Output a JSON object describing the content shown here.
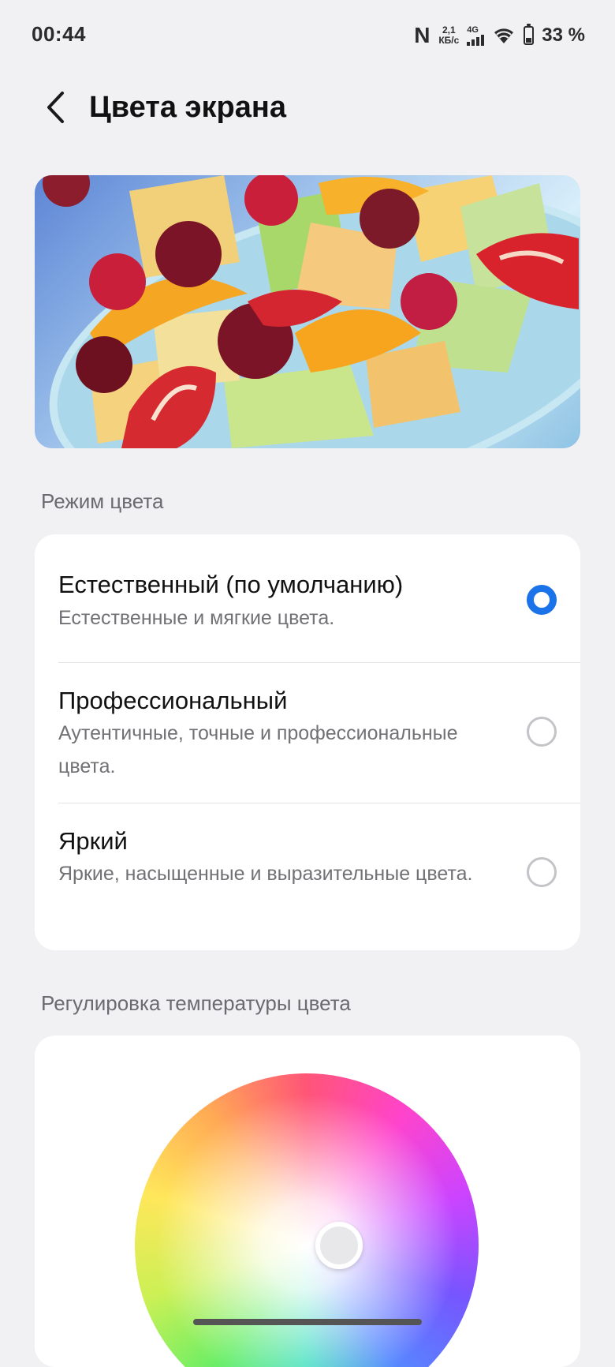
{
  "status_bar": {
    "time": "00:44",
    "network_speed_value": "2,1",
    "network_speed_unit": "КБ/с",
    "network_type": "4G",
    "battery_text": "33 %",
    "battery_level": 0.33
  },
  "header": {
    "title": "Цвета экрана",
    "back_icon": "chevron-left-icon"
  },
  "hero_image": {
    "subject": "fruit salad in a blue bowl"
  },
  "color_mode": {
    "section_title": "Режим цвета",
    "options": [
      {
        "title": "Естественный (по умолчанию)",
        "description": "Естественные и мягкие цвета.",
        "selected": true
      },
      {
        "title": "Профессиональный",
        "description": "Аутентичные, точные и профессиональные цвета.",
        "selected": false
      },
      {
        "title": "Яркий",
        "description": "Яркие, насыщенные и выразительные цвета.",
        "selected": false
      }
    ]
  },
  "color_temperature": {
    "section_title": "Регулировка температуры цвета"
  },
  "colors": {
    "background": "#f1f1f4",
    "card": "#ffffff",
    "accent": "#1a73e8",
    "secondary_text": "#717176"
  }
}
